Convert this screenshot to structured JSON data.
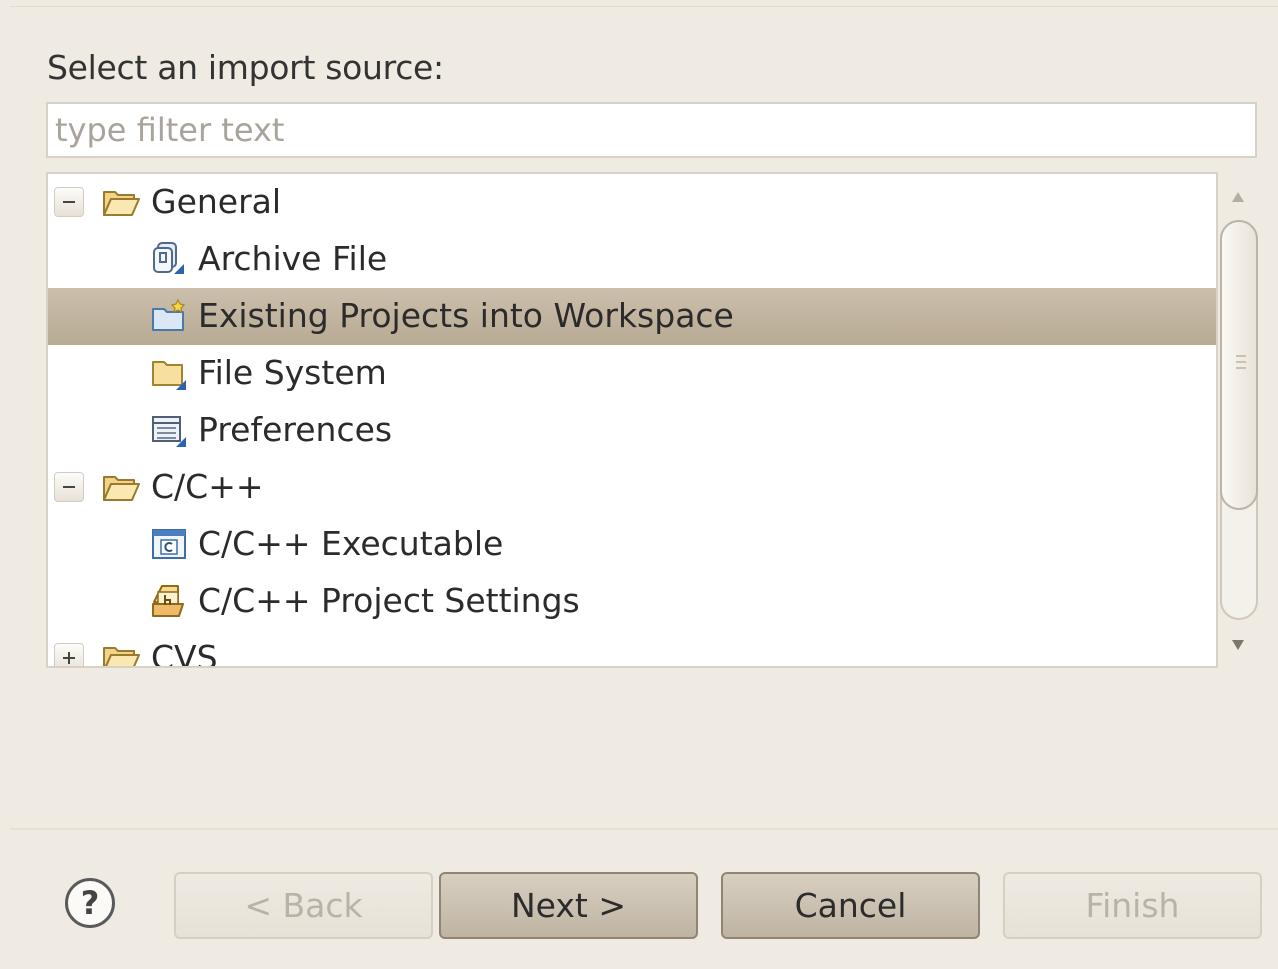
{
  "dialog": {
    "heading": "Select an import source:",
    "filter_placeholder": "type filter text",
    "filter_value": ""
  },
  "tree": {
    "items": [
      {
        "label": "General",
        "type": "category",
        "expanded": true
      },
      {
        "label": "Archive File",
        "type": "wizard",
        "icon": "archive-file-icon"
      },
      {
        "label": "Existing Projects into Workspace",
        "type": "wizard",
        "icon": "existing-projects-icon",
        "selected": true
      },
      {
        "label": "File System",
        "type": "wizard",
        "icon": "file-system-icon"
      },
      {
        "label": "Preferences",
        "type": "wizard",
        "icon": "preferences-icon"
      },
      {
        "label": "C/C++",
        "type": "category",
        "expanded": true
      },
      {
        "label": "C/C++ Executable",
        "type": "wizard",
        "icon": "cpp-executable-icon"
      },
      {
        "label": "C/C++ Project Settings",
        "type": "wizard",
        "icon": "cpp-project-settings-icon"
      },
      {
        "label": "CVS",
        "type": "category",
        "expanded": false
      }
    ]
  },
  "buttons": {
    "help": "?",
    "back": "< Back",
    "next": "Next >",
    "cancel": "Cancel",
    "finish": "Finish"
  },
  "colors": {
    "background": "#f0ebe2",
    "selection": "#c2b6a1",
    "button": "#cdc3b3"
  }
}
